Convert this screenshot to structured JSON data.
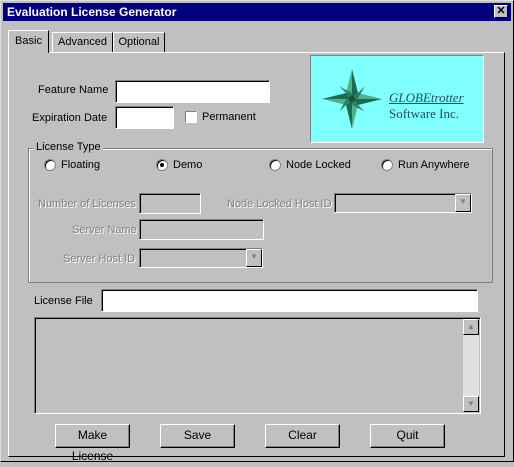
{
  "window": {
    "title": "Evaluation License Generator",
    "close_glyph": "✕"
  },
  "tabs": [
    {
      "label": "Basic",
      "active": true
    },
    {
      "label": "Advanced",
      "active": false
    },
    {
      "label": "Optional",
      "active": false
    }
  ],
  "basic": {
    "feature_name": {
      "label": "Feature Name",
      "value": ""
    },
    "expiration_date": {
      "label": "Expiration Date",
      "value": ""
    },
    "permanent": {
      "label": "Permanent",
      "checked": false
    },
    "logo": {
      "text_line1": "GLOBEtrotter",
      "text_line2": "Software Inc.",
      "color": "#80ffff"
    },
    "license_type": {
      "title": "License Type",
      "options": [
        {
          "label": "Floating",
          "selected": false
        },
        {
          "label": "Demo",
          "selected": true
        },
        {
          "label": "Node Locked",
          "selected": false
        },
        {
          "label": "Run Anywhere",
          "selected": false
        }
      ]
    },
    "number_of_licenses": {
      "label": "Number of Licenses",
      "value": ""
    },
    "node_locked_host_id": {
      "label": "Node Locked Host ID",
      "value": ""
    },
    "server_name": {
      "label": "Server Name",
      "value": ""
    },
    "server_host_id": {
      "label": "Server Host ID",
      "value": ""
    },
    "license_file": {
      "label": "License File",
      "value": ""
    },
    "output_text": ""
  },
  "buttons": {
    "make_license": "Make License",
    "save": "Save",
    "clear": "Clear",
    "quit": "Quit"
  },
  "colors": {
    "titlebar": "#000080",
    "face": "#c0c0c0"
  }
}
